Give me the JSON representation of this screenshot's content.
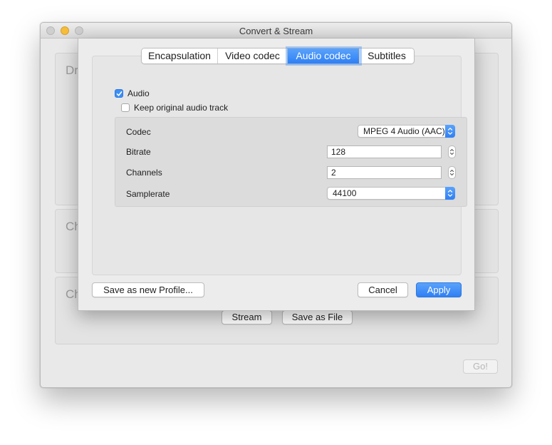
{
  "window": {
    "title": "Convert & Stream",
    "group_labels": [
      "Drop media here",
      "Choose Profile",
      "Choose Destination"
    ],
    "buttons": {
      "stream": "Stream",
      "save_as_file": "Save as File",
      "go": "Go!"
    }
  },
  "dialog": {
    "tabs": [
      {
        "label": "Encapsulation",
        "selected": false
      },
      {
        "label": "Video codec",
        "selected": false
      },
      {
        "label": "Audio codec",
        "selected": true
      },
      {
        "label": "Subtitles",
        "selected": false
      }
    ],
    "audio_checkbox": {
      "label": "Audio",
      "checked": true
    },
    "keep_original_checkbox": {
      "label": "Keep original audio track",
      "checked": false
    },
    "fields": {
      "codec": {
        "label": "Codec",
        "value": "MPEG 4 Audio (AAC)"
      },
      "bitrate": {
        "label": "Bitrate",
        "value": "128"
      },
      "channels": {
        "label": "Channels",
        "value": "2"
      },
      "samplerate": {
        "label": "Samplerate",
        "value": "44100"
      }
    },
    "buttons": {
      "save_profile": "Save as new Profile...",
      "cancel": "Cancel",
      "apply": "Apply"
    }
  },
  "icons": {
    "close": "close-icon",
    "minimize": "minimize-icon",
    "zoom": "zoom-icon",
    "check": "checkmark-icon",
    "popup_arrows": "up-down-chevron-icon",
    "stepper": "stepper-arrows-icon"
  },
  "colors": {
    "accent": "#2f7ff5",
    "accent_light": "#5aa3fb",
    "minimize": "#f5bd3a"
  }
}
